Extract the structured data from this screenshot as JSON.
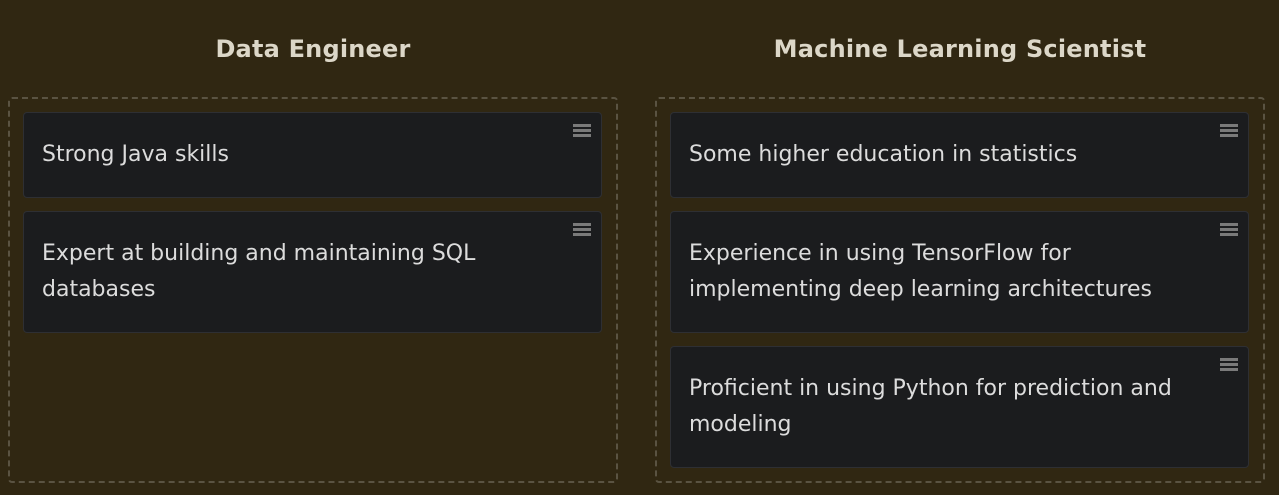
{
  "columns": [
    {
      "title": "Data Engineer",
      "cards": [
        {
          "text": "Strong Java skills",
          "handle_icon": "drag-handle-icon"
        },
        {
          "text": "Expert at building and maintaining SQL databases",
          "handle_icon": "drag-handle-icon"
        }
      ]
    },
    {
      "title": "Machine Learning Scientist",
      "cards": [
        {
          "text": "Some higher education in statistics",
          "handle_icon": "drag-handle-icon"
        },
        {
          "text": "Experience in using TensorFlow for implementing deep learning architectures",
          "handle_icon": "drag-handle-icon"
        },
        {
          "text": "Proficient in using Python for prediction and modeling",
          "handle_icon": "drag-handle-icon"
        }
      ]
    }
  ],
  "colors": {
    "background": "#302712",
    "card": "#1b1c1e",
    "dropzone_border": "#5a5342",
    "title_text": "#dcd7c8",
    "card_text": "#dcdcdc",
    "handle": "#7a7a7a"
  }
}
